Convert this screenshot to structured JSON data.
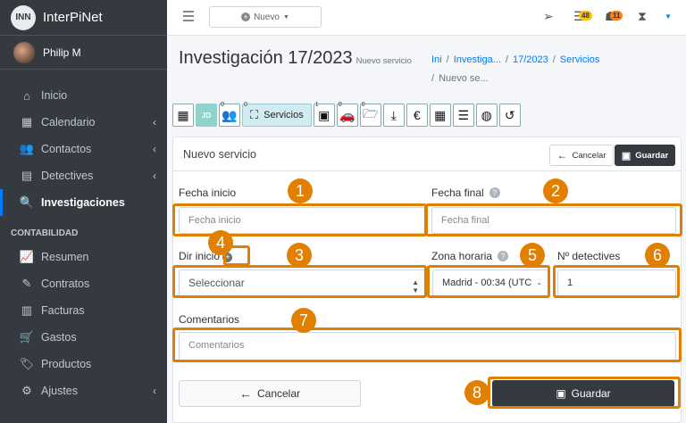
{
  "app": {
    "logo_text": "INN",
    "name": "InterPiNet"
  },
  "user": {
    "name": "Philip M"
  },
  "sidebar": {
    "items": [
      {
        "label": "Inicio",
        "icon": "home-icon",
        "glyph": "⌂",
        "chevron": false
      },
      {
        "label": "Calendario",
        "icon": "calendar-icon",
        "glyph": "▦",
        "chevron": true
      },
      {
        "label": "Contactos",
        "icon": "users-icon",
        "glyph": "👥",
        "chevron": true
      },
      {
        "label": "Detectives",
        "icon": "building-icon",
        "glyph": "▤",
        "chevron": true
      },
      {
        "label": "Investigaciones",
        "icon": "search-icon",
        "glyph": "🔍",
        "chevron": false,
        "active": true
      }
    ],
    "section_header": "CONTABILIDAD",
    "accounting_items": [
      {
        "label": "Resumen",
        "icon": "chart-line-icon",
        "glyph": "📈",
        "chevron": false
      },
      {
        "label": "Contratos",
        "icon": "file-signature-icon",
        "glyph": "✎",
        "chevron": false
      },
      {
        "label": "Facturas",
        "icon": "invoice-icon",
        "glyph": "▥",
        "chevron": false
      },
      {
        "label": "Gastos",
        "icon": "cart-icon",
        "glyph": "🛒",
        "chevron": false
      },
      {
        "label": "Productos",
        "icon": "tags-icon",
        "glyph": "🏷",
        "chevron": false
      },
      {
        "label": "Ajustes",
        "icon": "cogs-icon",
        "glyph": "⚙",
        "chevron": true
      }
    ]
  },
  "topbar": {
    "new_button": "Nuevo",
    "badge_messages": "48",
    "badge_alerts": "11"
  },
  "page": {
    "title": "Investigación 17/2023",
    "subtitle": "Nuevo servicio",
    "breadcrumb": [
      "Ini",
      "Investiga...",
      "17/2023",
      "Servicios"
    ],
    "breadcrumb_current": "Nuevo se..."
  },
  "tabs": {
    "initials": "JD",
    "active_label": "Servicios",
    "counts": {
      "team": "0",
      "services": "0",
      "camera": "1",
      "car": "0",
      "folder": "0"
    }
  },
  "form": {
    "card_title": "Nuevo servicio",
    "cancel_label": "Cancelar",
    "save_label": "Guardar",
    "fecha_inicio_label": "Fecha inicio",
    "fecha_inicio_placeholder": "Fecha inicio",
    "fecha_final_label": "Fecha final",
    "fecha_final_placeholder": "Fecha final",
    "dir_inicio_label": "Dir inicio",
    "dir_inicio_value": "Seleccionar",
    "zona_label": "Zona horaria",
    "zona_value": "Madrid - 00:34 (UTC",
    "detectives_label": "Nº detectives",
    "detectives_value": "1",
    "comentarios_label": "Comentarios",
    "comentarios_placeholder": "Comentarios"
  },
  "callouts": [
    "1",
    "2",
    "3",
    "4",
    "5",
    "6",
    "7",
    "8"
  ],
  "colors": {
    "highlight": "#e07f00",
    "sidebar": "#343a40",
    "accent": "#007bff"
  }
}
